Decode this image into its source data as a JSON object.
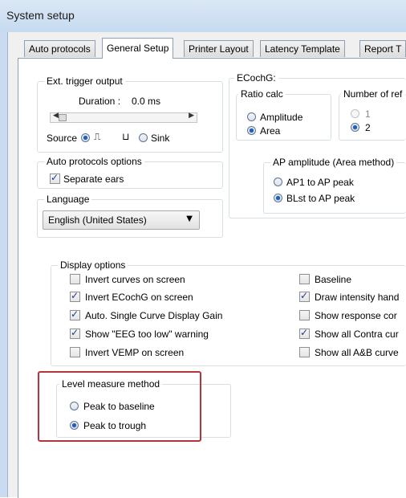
{
  "window": {
    "title": "System setup"
  },
  "tabs": [
    {
      "label": "Auto protocols"
    },
    {
      "label": "General Setup"
    },
    {
      "label": "Printer Layout"
    },
    {
      "label": "Latency Template"
    },
    {
      "label": "Report T"
    }
  ],
  "ext_trigger": {
    "legend": "Ext. trigger output",
    "duration_label": "Duration :",
    "duration_value": "0.0 ms",
    "source_label": "Source",
    "sink_label": "Sink",
    "selected": "pulse"
  },
  "auto_protocols_options": {
    "legend": "Auto protocols options",
    "separate_ears_label": "Separate ears",
    "separate_ears_checked": true
  },
  "language": {
    "legend": "Language",
    "selected": "English (United States)"
  },
  "ecochg": {
    "legend": "ECochG:",
    "ratio_calc_legend": "Ratio calc",
    "amplitude_label": "Amplitude",
    "area_label": "Area",
    "selected": "Area",
    "number_of_ref_legend": "Number of ref",
    "ref_options": [
      "1",
      "2"
    ],
    "ref_selected": "2",
    "ap_amplitude_legend": "AP amplitude (Area method)",
    "ap1_label": "AP1 to AP peak",
    "blst_label": "BLst to AP peak",
    "ap_selected": "BLst to AP peak"
  },
  "display_options": {
    "legend": "Display options",
    "left": [
      {
        "label": "Invert curves on screen",
        "checked": false
      },
      {
        "label": "Invert ECochG on screen",
        "checked": true
      },
      {
        "label": "Auto. Single Curve Display Gain",
        "checked": true
      },
      {
        "label": "Show \"EEG too low\" warning",
        "checked": true
      },
      {
        "label": "Invert VEMP on screen",
        "checked": false
      }
    ],
    "right": [
      {
        "label": "Baseline",
        "checked": false
      },
      {
        "label": "Draw intensity hand",
        "checked": true
      },
      {
        "label": "Show response cor",
        "checked": false
      },
      {
        "label": "Show all Contra cur",
        "checked": true
      },
      {
        "label": "Show all A&B curve",
        "checked": false
      }
    ]
  },
  "level_measure": {
    "legend": "Level measure method",
    "options": [
      "Peak to baseline",
      "Peak to trough"
    ],
    "selected": "Peak to trough"
  },
  "colors": {
    "highlight_border": "#b5343c",
    "radio_selected": "#1f5fbf"
  }
}
